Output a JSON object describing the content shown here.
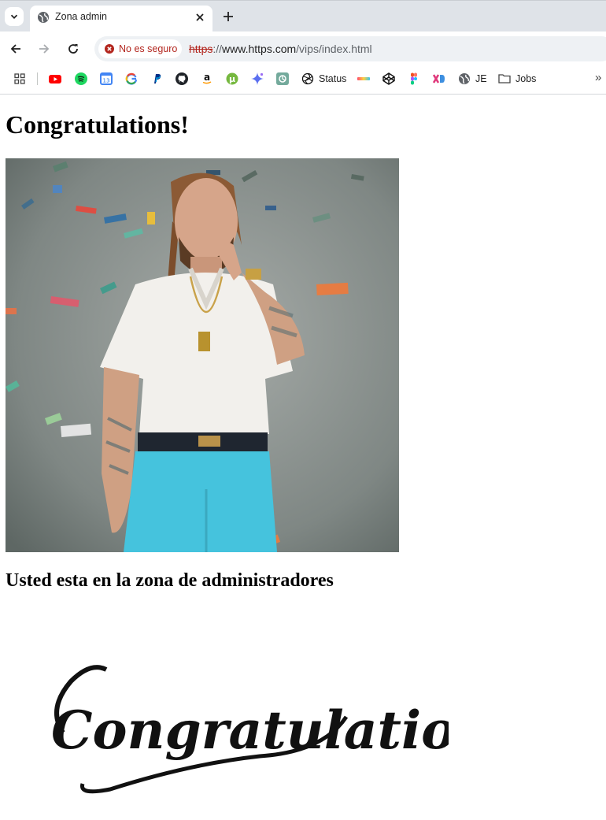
{
  "browser": {
    "tab": {
      "title": "Zona admin"
    },
    "address_bar": {
      "security_label": "No es seguro",
      "url_scheme": "https",
      "url_separator": "://",
      "url_host": "www.https.com",
      "url_path": "/vips/index.html"
    },
    "bookmarks": [
      {
        "icon": "apps-grid-icon"
      },
      {
        "icon": "youtube-icon"
      },
      {
        "icon": "spotify-icon"
      },
      {
        "icon": "calendar-icon"
      },
      {
        "icon": "google-icon"
      },
      {
        "icon": "paypal-icon"
      },
      {
        "icon": "github-icon"
      },
      {
        "icon": "amazon-icon"
      },
      {
        "icon": "utorrent-icon"
      },
      {
        "icon": "gemini-icon"
      },
      {
        "icon": "chatgpt-icon"
      },
      {
        "icon": "openai-icon",
        "label": "Status"
      },
      {
        "icon": "gradient-bar-icon"
      },
      {
        "icon": "codepen-icon"
      },
      {
        "icon": "figma-icon"
      },
      {
        "icon": "xd-icon"
      },
      {
        "icon": "globe-icon",
        "label": "JE"
      },
      {
        "icon": "folder-icon",
        "label": "Jobs"
      }
    ],
    "overflow_label": "»"
  },
  "page": {
    "heading": "Congratulations!",
    "subheading": "Usted esta en la zona de administradores",
    "lettering_text": "Congratulations!"
  },
  "colors": {
    "tabstrip": "#dfe3e8",
    "omnibox": "#eef1f4",
    "warning": "#b3261e",
    "shirt": "#f2f0ec",
    "pants": "#45c3dd"
  }
}
